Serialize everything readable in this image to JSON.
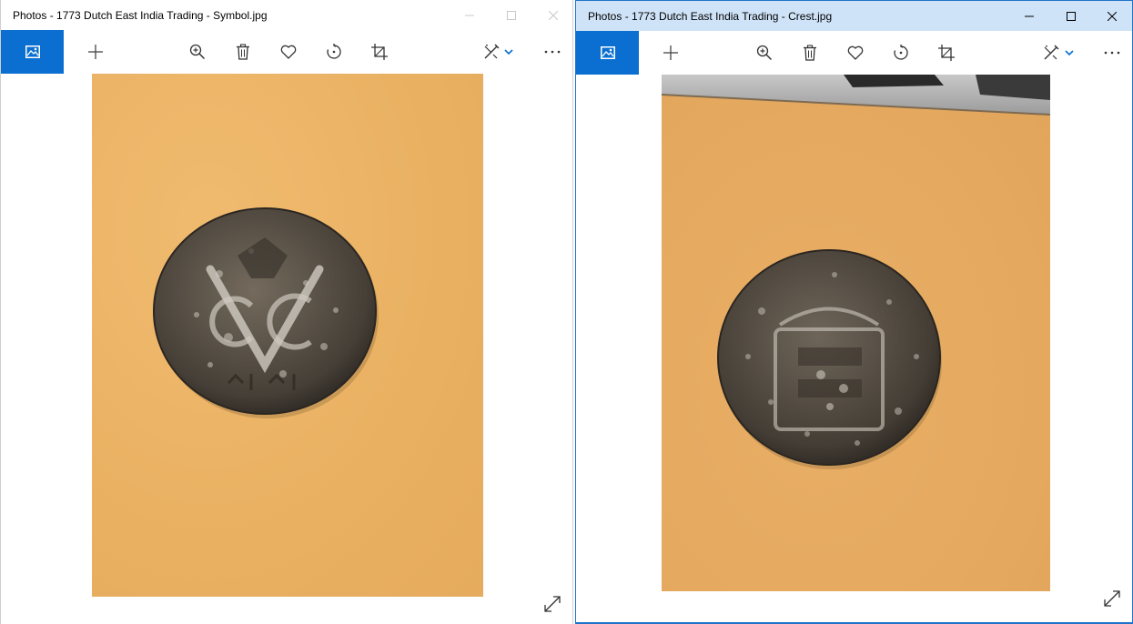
{
  "windows": [
    {
      "id": "left",
      "title": "Photos - 1773 Dutch East India Trading - Symbol.jpg",
      "active": false,
      "photo_subject": "coin-obverse-voc-monogram"
    },
    {
      "id": "right",
      "title": "Photos - 1773 Dutch East India Trading - Crest.jpg",
      "active": true,
      "photo_subject": "coin-reverse-crest"
    }
  ],
  "toolbar": {
    "icons": [
      "collection-icon",
      "add-icon",
      "zoom-in-icon",
      "delete-icon",
      "favorite-icon",
      "rotate-icon",
      "crop-icon",
      "edit-create-icon",
      "chevron-down-icon",
      "more-icon"
    ]
  },
  "colors": {
    "accent": "#0a6fd0",
    "active_titlebar": "#cfe3f8",
    "inactive_titlebar": "#ffffff",
    "photo_background": "#ecb365"
  }
}
